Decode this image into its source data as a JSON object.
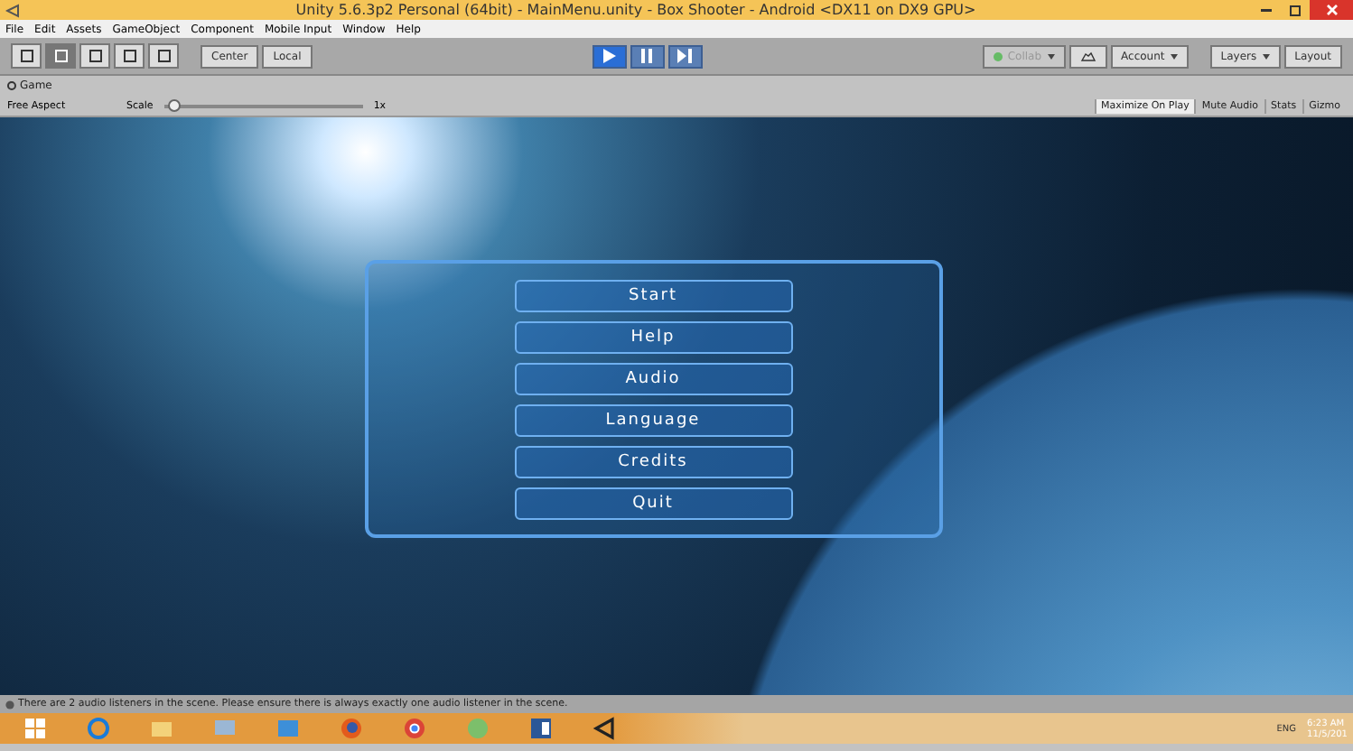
{
  "window": {
    "title": "Unity 5.6.3p2 Personal (64bit) - MainMenu.unity - Box Shooter - Android <DX11 on DX9 GPU>"
  },
  "menu_bar": [
    "File",
    "Edit",
    "Assets",
    "GameObject",
    "Component",
    "Mobile Input",
    "Window",
    "Help"
  ],
  "toolbar": {
    "pivot_buttons": [
      "Center",
      "Local"
    ],
    "play_controls": [
      {
        "kind": "play",
        "selected": true
      },
      {
        "kind": "pause",
        "selected": false
      },
      {
        "kind": "step",
        "selected": false
      }
    ],
    "collab": {
      "label": "Collab",
      "disabled": true
    },
    "account": "Account",
    "layers": "Layers",
    "layout": "Layout"
  },
  "game_panel": {
    "tab": "Game",
    "aspect": "Free Aspect",
    "scale_label": "Scale",
    "scale_value": "1x",
    "scale": {
      "level": 0.02
    },
    "toggles": [
      {
        "label": "Maximize On Play",
        "selected": true
      },
      {
        "label": "Mute Audio",
        "selected": false
      },
      {
        "label": "Stats",
        "selected": false
      },
      {
        "label": "Gizmo",
        "selected": false
      }
    ],
    "menu_buttons": [
      "Start",
      "Help",
      "Audio",
      "Language",
      "Credits",
      "Quit"
    ]
  },
  "status_bar": "There are 2 audio listeners in the scene. Please ensure there is always exactly one audio listener in the scene.",
  "taskbar": {
    "language": "ENG",
    "time": "6:23 AM",
    "date": "11/5/201"
  }
}
